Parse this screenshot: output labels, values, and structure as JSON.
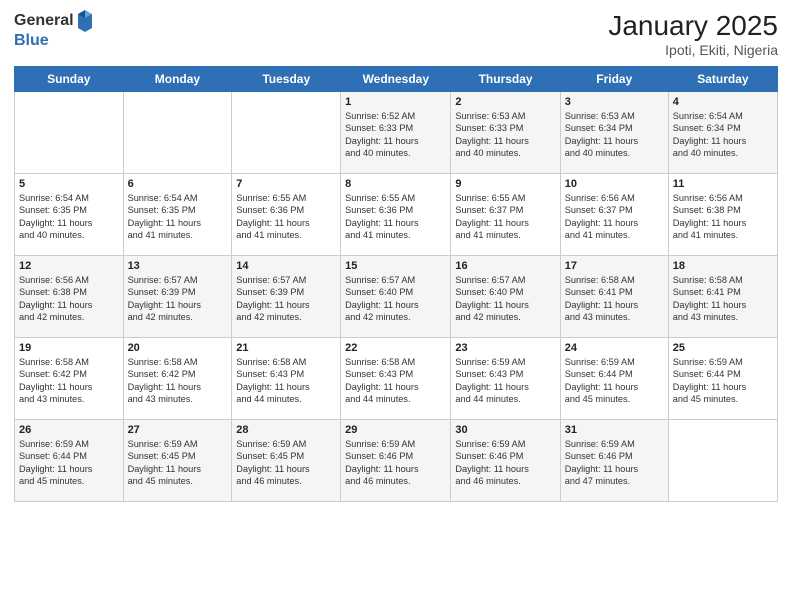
{
  "header": {
    "logo_general": "General",
    "logo_blue": "Blue",
    "month": "January 2025",
    "location": "Ipoti, Ekiti, Nigeria"
  },
  "weekdays": [
    "Sunday",
    "Monday",
    "Tuesday",
    "Wednesday",
    "Thursday",
    "Friday",
    "Saturday"
  ],
  "weeks": [
    [
      {
        "day": "",
        "info": ""
      },
      {
        "day": "",
        "info": ""
      },
      {
        "day": "",
        "info": ""
      },
      {
        "day": "1",
        "info": "Sunrise: 6:52 AM\nSunset: 6:33 PM\nDaylight: 11 hours\nand 40 minutes."
      },
      {
        "day": "2",
        "info": "Sunrise: 6:53 AM\nSunset: 6:33 PM\nDaylight: 11 hours\nand 40 minutes."
      },
      {
        "day": "3",
        "info": "Sunrise: 6:53 AM\nSunset: 6:34 PM\nDaylight: 11 hours\nand 40 minutes."
      },
      {
        "day": "4",
        "info": "Sunrise: 6:54 AM\nSunset: 6:34 PM\nDaylight: 11 hours\nand 40 minutes."
      }
    ],
    [
      {
        "day": "5",
        "info": "Sunrise: 6:54 AM\nSunset: 6:35 PM\nDaylight: 11 hours\nand 40 minutes."
      },
      {
        "day": "6",
        "info": "Sunrise: 6:54 AM\nSunset: 6:35 PM\nDaylight: 11 hours\nand 41 minutes."
      },
      {
        "day": "7",
        "info": "Sunrise: 6:55 AM\nSunset: 6:36 PM\nDaylight: 11 hours\nand 41 minutes."
      },
      {
        "day": "8",
        "info": "Sunrise: 6:55 AM\nSunset: 6:36 PM\nDaylight: 11 hours\nand 41 minutes."
      },
      {
        "day": "9",
        "info": "Sunrise: 6:55 AM\nSunset: 6:37 PM\nDaylight: 11 hours\nand 41 minutes."
      },
      {
        "day": "10",
        "info": "Sunrise: 6:56 AM\nSunset: 6:37 PM\nDaylight: 11 hours\nand 41 minutes."
      },
      {
        "day": "11",
        "info": "Sunrise: 6:56 AM\nSunset: 6:38 PM\nDaylight: 11 hours\nand 41 minutes."
      }
    ],
    [
      {
        "day": "12",
        "info": "Sunrise: 6:56 AM\nSunset: 6:38 PM\nDaylight: 11 hours\nand 42 minutes."
      },
      {
        "day": "13",
        "info": "Sunrise: 6:57 AM\nSunset: 6:39 PM\nDaylight: 11 hours\nand 42 minutes."
      },
      {
        "day": "14",
        "info": "Sunrise: 6:57 AM\nSunset: 6:39 PM\nDaylight: 11 hours\nand 42 minutes."
      },
      {
        "day": "15",
        "info": "Sunrise: 6:57 AM\nSunset: 6:40 PM\nDaylight: 11 hours\nand 42 minutes."
      },
      {
        "day": "16",
        "info": "Sunrise: 6:57 AM\nSunset: 6:40 PM\nDaylight: 11 hours\nand 42 minutes."
      },
      {
        "day": "17",
        "info": "Sunrise: 6:58 AM\nSunset: 6:41 PM\nDaylight: 11 hours\nand 43 minutes."
      },
      {
        "day": "18",
        "info": "Sunrise: 6:58 AM\nSunset: 6:41 PM\nDaylight: 11 hours\nand 43 minutes."
      }
    ],
    [
      {
        "day": "19",
        "info": "Sunrise: 6:58 AM\nSunset: 6:42 PM\nDaylight: 11 hours\nand 43 minutes."
      },
      {
        "day": "20",
        "info": "Sunrise: 6:58 AM\nSunset: 6:42 PM\nDaylight: 11 hours\nand 43 minutes."
      },
      {
        "day": "21",
        "info": "Sunrise: 6:58 AM\nSunset: 6:43 PM\nDaylight: 11 hours\nand 44 minutes."
      },
      {
        "day": "22",
        "info": "Sunrise: 6:58 AM\nSunset: 6:43 PM\nDaylight: 11 hours\nand 44 minutes."
      },
      {
        "day": "23",
        "info": "Sunrise: 6:59 AM\nSunset: 6:43 PM\nDaylight: 11 hours\nand 44 minutes."
      },
      {
        "day": "24",
        "info": "Sunrise: 6:59 AM\nSunset: 6:44 PM\nDaylight: 11 hours\nand 45 minutes."
      },
      {
        "day": "25",
        "info": "Sunrise: 6:59 AM\nSunset: 6:44 PM\nDaylight: 11 hours\nand 45 minutes."
      }
    ],
    [
      {
        "day": "26",
        "info": "Sunrise: 6:59 AM\nSunset: 6:44 PM\nDaylight: 11 hours\nand 45 minutes."
      },
      {
        "day": "27",
        "info": "Sunrise: 6:59 AM\nSunset: 6:45 PM\nDaylight: 11 hours\nand 45 minutes."
      },
      {
        "day": "28",
        "info": "Sunrise: 6:59 AM\nSunset: 6:45 PM\nDaylight: 11 hours\nand 46 minutes."
      },
      {
        "day": "29",
        "info": "Sunrise: 6:59 AM\nSunset: 6:46 PM\nDaylight: 11 hours\nand 46 minutes."
      },
      {
        "day": "30",
        "info": "Sunrise: 6:59 AM\nSunset: 6:46 PM\nDaylight: 11 hours\nand 46 minutes."
      },
      {
        "day": "31",
        "info": "Sunrise: 6:59 AM\nSunset: 6:46 PM\nDaylight: 11 hours\nand 47 minutes."
      },
      {
        "day": "",
        "info": ""
      }
    ]
  ]
}
